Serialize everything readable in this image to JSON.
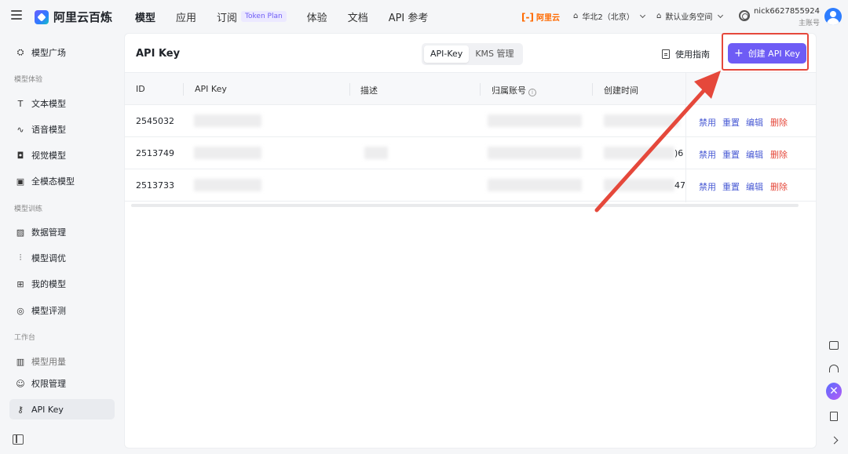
{
  "app": {
    "name": "阿里云百炼"
  },
  "topnav": [
    {
      "label": "模型",
      "active": true
    },
    {
      "label": "应用",
      "active": false
    },
    {
      "label": "订阅",
      "badge": "Token Plan",
      "active": false
    },
    {
      "label": "体验",
      "active": false
    },
    {
      "label": "文档",
      "active": false
    },
    {
      "label": "API 参考",
      "active": false
    }
  ],
  "header": {
    "aliyun_label": "阿里云",
    "region": "华北2（北京）",
    "workspace": "默认业务空间",
    "account_name": "nick6627855924",
    "account_role": "主账号"
  },
  "sidebar": {
    "items": [
      {
        "label": "模型广场",
        "icon": "model-market-icon"
      },
      {
        "group": "模型体验"
      },
      {
        "label": "文本模型",
        "icon": "text-icon"
      },
      {
        "label": "语音模型",
        "icon": "audio-icon"
      },
      {
        "label": "视觉模型",
        "icon": "camera-icon"
      },
      {
        "label": "全模态模型",
        "icon": "multimodal-icon"
      },
      {
        "group": "模型训练"
      },
      {
        "label": "数据管理",
        "icon": "chart-icon"
      },
      {
        "label": "模型调优",
        "icon": "tune-icon"
      },
      {
        "label": "我的模型",
        "icon": "grid-icon"
      },
      {
        "label": "模型评测",
        "icon": "compass-icon"
      },
      {
        "group": "工作台"
      },
      {
        "label": "模型用量",
        "icon": "bar-icon",
        "muted": true
      },
      {
        "label": "权限管理",
        "icon": "user-icon"
      },
      {
        "label": "API Key",
        "icon": "key-icon",
        "active": true
      }
    ]
  },
  "page": {
    "title": "API Key",
    "segments": [
      "API-Key",
      "KMS 管理"
    ],
    "active_segment": "API-Key",
    "guide_label": "使用指南",
    "create_label": "创建 API Key"
  },
  "table": {
    "columns": [
      "ID",
      "API Key",
      "描述",
      "归属账号",
      "创建时间"
    ],
    "rows": [
      {
        "id": "2545032",
        "time_suffix": ""
      },
      {
        "id": "2513749",
        "time_suffix": ")6"
      },
      {
        "id": "2513733",
        "time_suffix": "47"
      }
    ],
    "actions": [
      {
        "label": "禁用",
        "danger": false
      },
      {
        "label": "重置",
        "danger": false
      },
      {
        "label": "编辑",
        "danger": false
      },
      {
        "label": "删除",
        "danger": true
      }
    ]
  },
  "colors": {
    "accent": "#6e5cf5",
    "link": "#4a5bd4",
    "danger": "#e5483b",
    "annotation": "#e5483b"
  }
}
